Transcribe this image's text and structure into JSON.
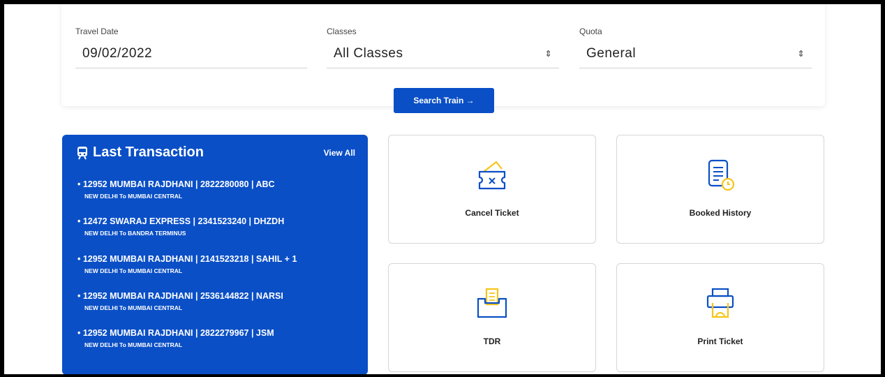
{
  "search": {
    "travel_date": {
      "label": "Travel Date",
      "value": "09/02/2022"
    },
    "classes": {
      "label": "Classes",
      "value": "All Classes"
    },
    "quota": {
      "label": "Quota",
      "value": "General"
    },
    "select_arrow": "⇕",
    "button_label": "Search Train →"
  },
  "last_transaction": {
    "title": "Last Transaction",
    "view_all": "View All",
    "items": [
      {
        "line1": "• 12952 MUMBAI RAJDHANI  |  2822280080  |  ABC",
        "line2": "NEW DELHI To MUMBAI CENTRAL"
      },
      {
        "line1": "• 12472 SWARAJ EXPRESS  |  2341523240  |  DHZDH",
        "line2": "NEW DELHI To BANDRA TERMINUS"
      },
      {
        "line1": "• 12952 MUMBAI RAJDHANI  |  2141523218  |  SAHIL + 1",
        "line2": "NEW DELHI To MUMBAI CENTRAL"
      },
      {
        "line1": "• 12952 MUMBAI RAJDHANI  |  2536144822  |  NARSI",
        "line2": "NEW DELHI To MUMBAI CENTRAL"
      },
      {
        "line1": "• 12952 MUMBAI RAJDHANI  |  2822279967  |  JSM",
        "line2": "NEW DELHI To MUMBAI CENTRAL"
      }
    ]
  },
  "actions": {
    "cancel_ticket": "Cancel Ticket",
    "booked_history": "Booked History",
    "tdr": "TDR",
    "print_ticket": "Print Ticket"
  },
  "colors": {
    "primary": "#0a4fc6",
    "accent": "#f5c518"
  },
  "icons": [
    "train-icon",
    "cancel-ticket-icon",
    "booked-history-icon",
    "tdr-icon",
    "print-ticket-icon"
  ]
}
